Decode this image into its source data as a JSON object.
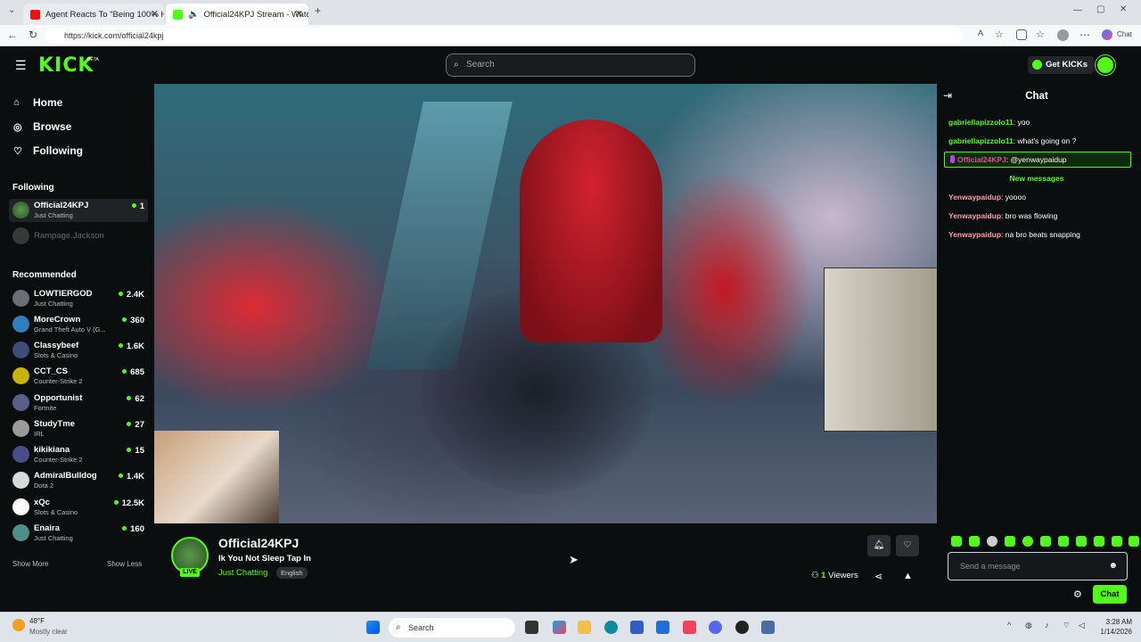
{
  "browser": {
    "tabs": [
      {
        "label": "Agent Reacts To \"Being 100% Hon",
        "active": false
      },
      {
        "label": "Official24KPJ Stream - Watch",
        "active": true
      }
    ],
    "url": "https://kick.com/official24kpj",
    "chat_label": "Chat"
  },
  "header": {
    "logo": "KICK",
    "beta": "BETA",
    "search_placeholder": "Search",
    "get_kicks": "Get KICKs"
  },
  "sidebar": {
    "nav": [
      {
        "label": "Home",
        "icon": "home-icon"
      },
      {
        "label": "Browse",
        "icon": "compass-icon"
      },
      {
        "label": "Following",
        "icon": "heart-icon"
      }
    ],
    "following_title": "Following",
    "following": [
      {
        "name": "Official24KPJ",
        "category": "Just Chatting",
        "viewers": "1"
      },
      {
        "name": "Rampage.Jackson",
        "category": "",
        "viewers": ""
      }
    ],
    "recommended_title": "Recommended",
    "recommended": [
      {
        "name": "LOWTIERGOD",
        "category": "Just Chatting",
        "viewers": "2.4K",
        "color": "#6b6f75"
      },
      {
        "name": "MoreCrown",
        "category": "Grand Theft Auto V (G...",
        "viewers": "360",
        "color": "#2f7fbf"
      },
      {
        "name": "Classybeef",
        "category": "Slots & Casino",
        "viewers": "1.6K",
        "color": "#3d4c7a"
      },
      {
        "name": "CCT_CS",
        "category": "Counter-Strike 2",
        "viewers": "685",
        "color": "#c8b400"
      },
      {
        "name": "Opportunist",
        "category": "Fortnite",
        "viewers": "62",
        "color": "#5a5f8a"
      },
      {
        "name": "StudyTme",
        "category": "IRL",
        "viewers": "27",
        "color": "#9a9a9a"
      },
      {
        "name": "kikikiana",
        "category": "Counter-Strike 2",
        "viewers": "15",
        "color": "#4a4e86"
      },
      {
        "name": "AdmiralBulldog",
        "category": "Dota 2",
        "viewers": "1.4K",
        "color": "#d9d9d9"
      },
      {
        "name": "xQc",
        "category": "Slots & Casino",
        "viewers": "12.5K",
        "color": "#ffffff"
      },
      {
        "name": "Enaira",
        "category": "Just Chatting",
        "viewers": "160",
        "color": "#4f8f8a"
      }
    ],
    "show_more": "Show More",
    "show_less": "Show Less"
  },
  "stream": {
    "name": "Official24KPJ",
    "title": "Ik You Not Sleep Tap In",
    "category": "Just Chatting",
    "language": "English",
    "live": "LIVE",
    "viewers_count": "1",
    "viewers_label": "Viewers"
  },
  "chat": {
    "title": "Chat",
    "messages": [
      {
        "user": "gabriellapizzolo11",
        "text": "yoo",
        "color": "#53fc18"
      },
      {
        "user": "gabriellapizzolo11",
        "text": "what's going on ?",
        "color": "#53fc18"
      },
      {
        "user": "Official24KPJ",
        "text": "@yenwaypaidup",
        "color": "#ff3fa4"
      }
    ],
    "new_messages": "New messages",
    "new": [
      {
        "user": "Yenwaypaidup",
        "text": "yoooo",
        "color": "#ff9ea8"
      },
      {
        "user": "Yenwaypaidup",
        "text": "bro was flowing",
        "color": "#ff9ea8"
      },
      {
        "user": "Yenwaypaidup",
        "text": "na bro beats snapping",
        "color": "#ff9ea8"
      }
    ],
    "placeholder": "Send a message",
    "send_label": "Chat"
  },
  "taskbar": {
    "temp": "48°F",
    "weather": "Mostly clear",
    "search": "Search",
    "time": "3:28 AM",
    "date": "1/14/2026"
  },
  "colors": {
    "accent": "#53fc18",
    "bg": "#0b0e0f"
  }
}
